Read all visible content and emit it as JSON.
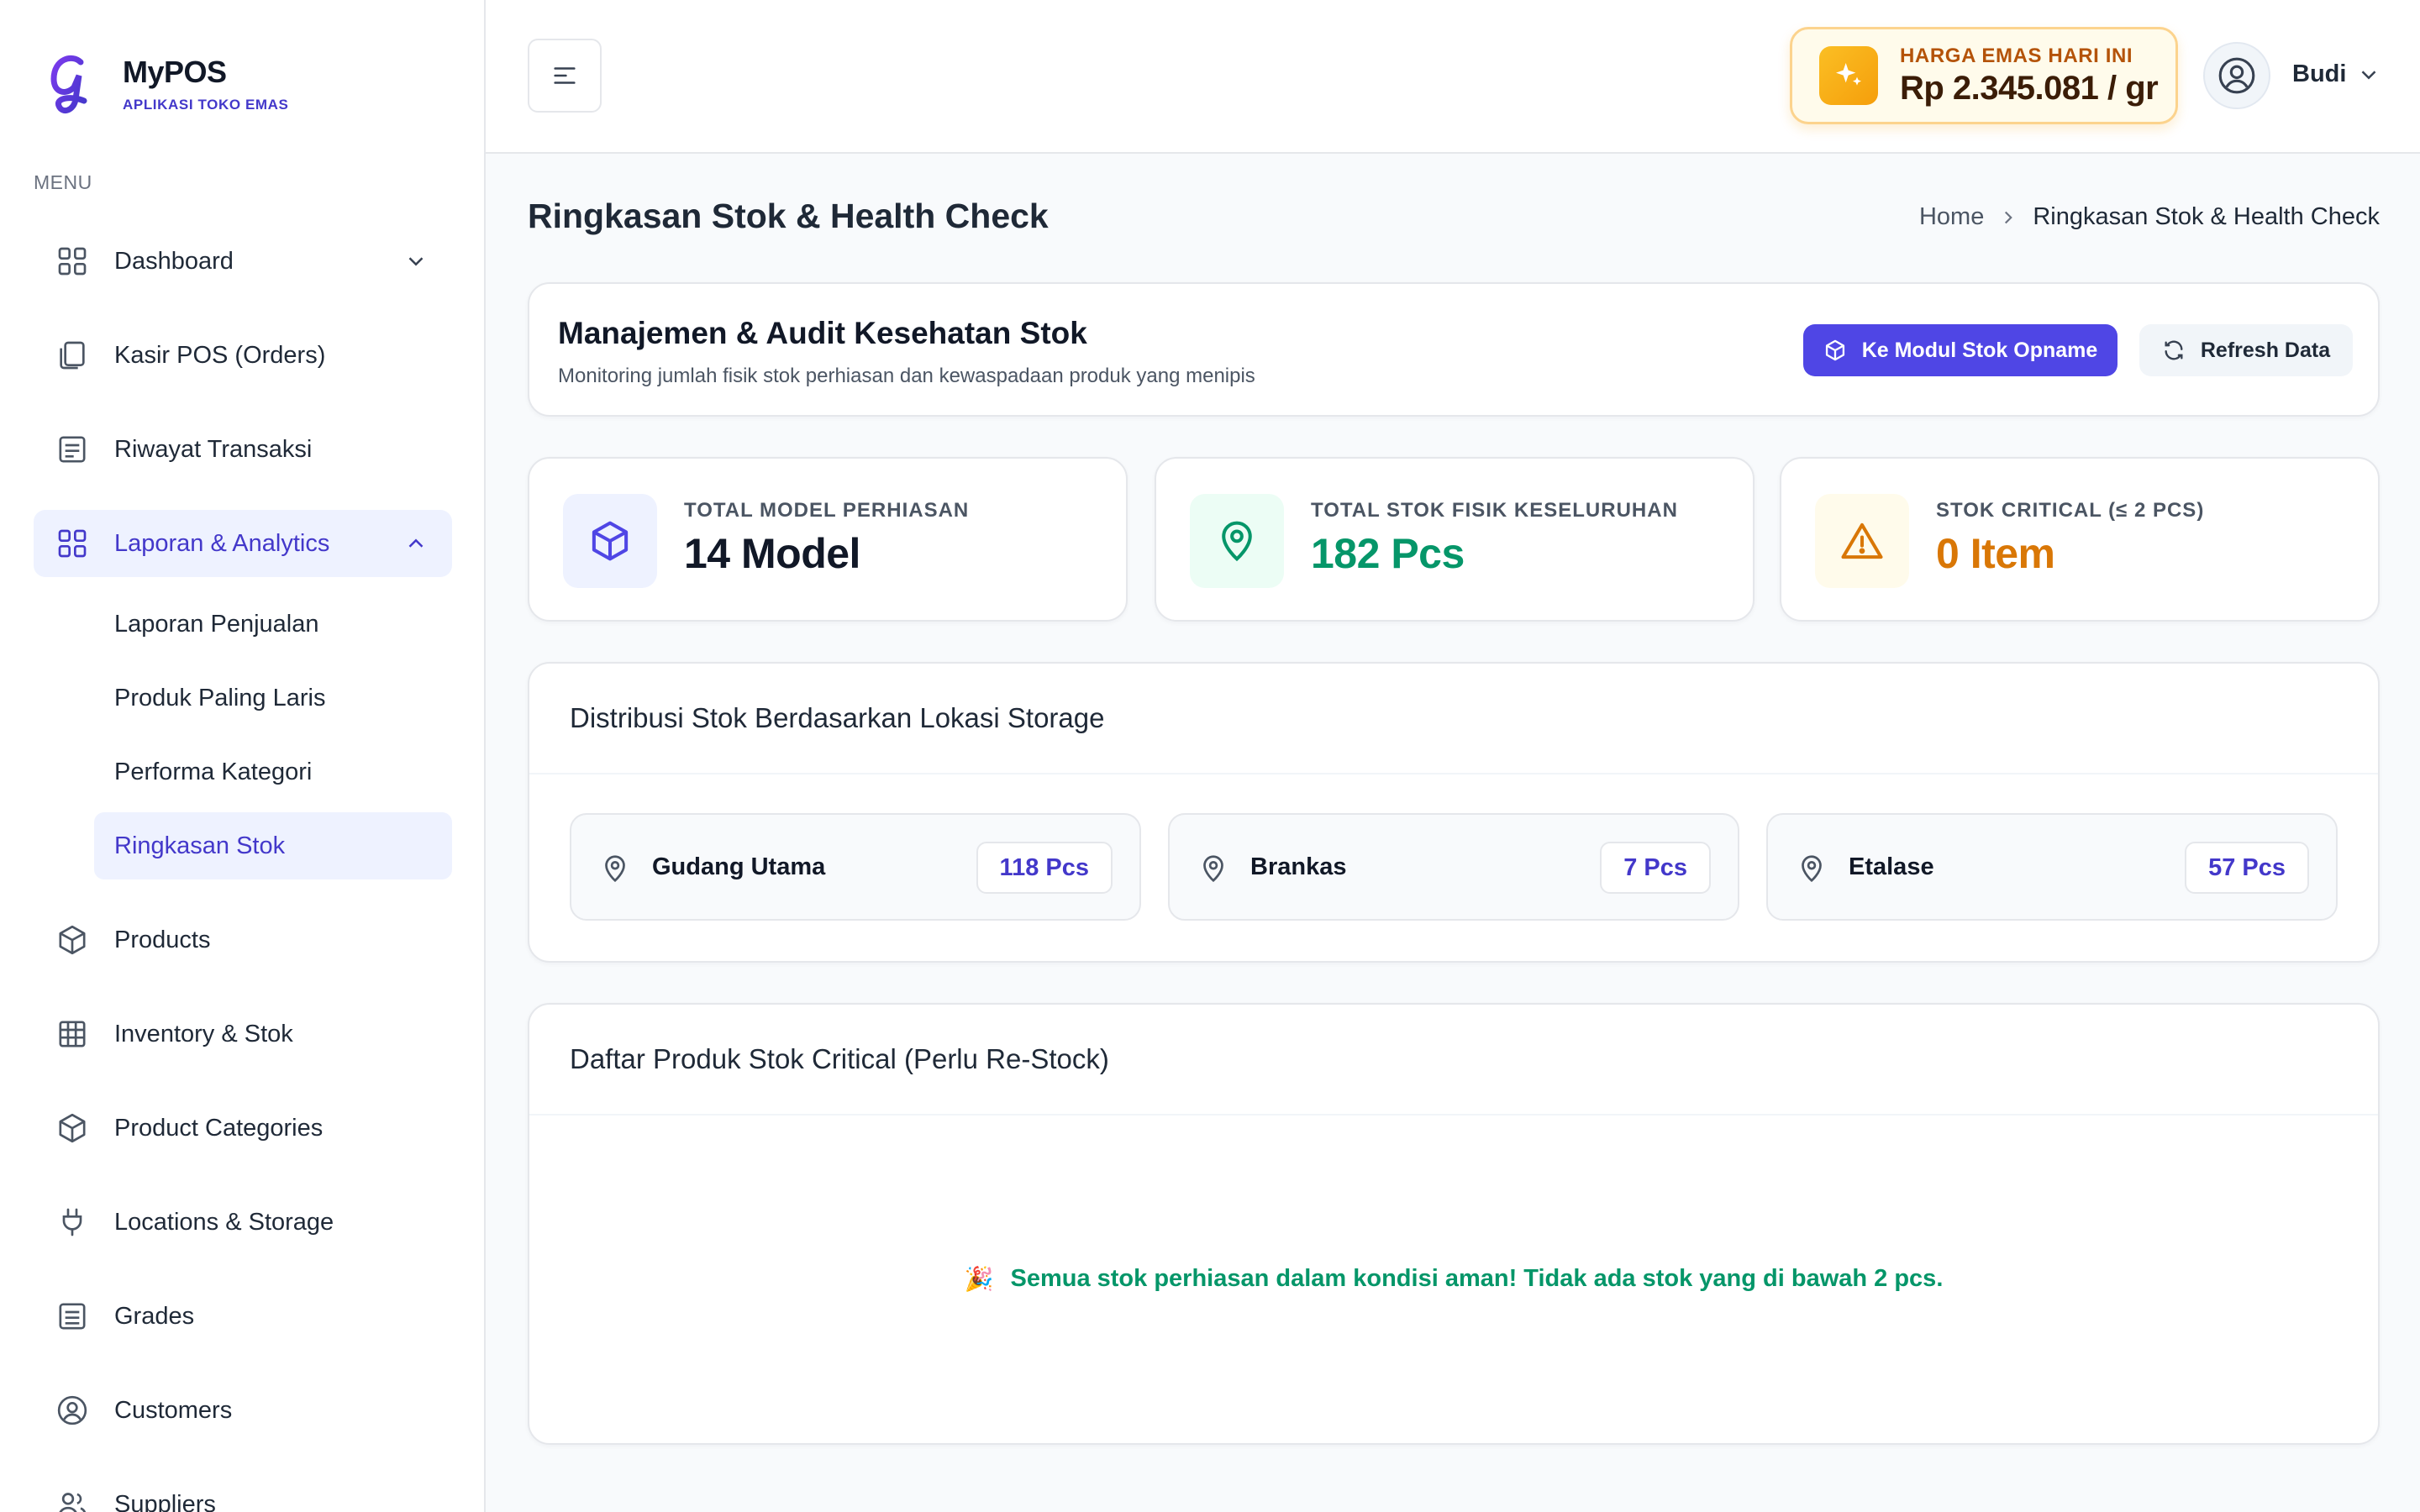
{
  "brand": {
    "title": "MyPOS",
    "subtitle": "APLIKASI TOKO EMAS",
    "logo_icon": "g-script-logo-icon"
  },
  "sidebar": {
    "menu_label": "MENU",
    "items": [
      {
        "label": "Dashboard",
        "icon": "grid-icon",
        "expanded": false
      },
      {
        "label": "Kasir POS (Orders)",
        "icon": "clipboard-icon"
      },
      {
        "label": "Riwayat Transaksi",
        "icon": "receipt-icon"
      },
      {
        "label": "Laporan & Analytics",
        "icon": "grid-icon",
        "expanded": true,
        "active": true
      },
      {
        "label": "Products",
        "icon": "cube-icon"
      },
      {
        "label": "Inventory & Stok",
        "icon": "table-icon"
      },
      {
        "label": "Product Categories",
        "icon": "cube-icon"
      },
      {
        "label": "Locations & Storage",
        "icon": "plug-icon"
      },
      {
        "label": "Grades",
        "icon": "list-icon"
      },
      {
        "label": "Customers",
        "icon": "user-circle-icon"
      },
      {
        "label": "Suppliers",
        "icon": "users-icon"
      }
    ],
    "subitems": [
      {
        "label": "Laporan Penjualan"
      },
      {
        "label": "Produk Paling Laris"
      },
      {
        "label": "Performa Kategori"
      },
      {
        "label": "Ringkasan Stok",
        "active": true
      }
    ]
  },
  "header": {
    "gold_price": {
      "label": "HARGA EMAS HARI INI",
      "value": "Rp 2.345.081 / gr",
      "icon": "sparkles-icon"
    },
    "user": {
      "name": "Budi"
    }
  },
  "page": {
    "title": "Ringkasan Stok & Health Check",
    "breadcrumb": {
      "home": "Home",
      "current": "Ringkasan Stok & Health Check"
    }
  },
  "management": {
    "title": "Manajemen & Audit Kesehatan Stok",
    "subtitle": "Monitoring jumlah fisik stok perhiasan dan kewaspadaan produk yang menipis",
    "primary_button": "Ke Modul Stok Opname",
    "secondary_button": "Refresh Data"
  },
  "stats": [
    {
      "label": "TOTAL MODEL PERHIASAN",
      "value": "14 Model",
      "icon": "cube-icon",
      "color": "#111827",
      "bg": "#eef2ff"
    },
    {
      "label": "TOTAL STOK FISIK KESELURUHAN",
      "value": "182 Pcs",
      "icon": "map-pin-icon",
      "color": "#059669",
      "bg": "#ecfdf5"
    },
    {
      "label": "STOK CRITICAL (≤ 2 PCS)",
      "value": "0 Item",
      "icon": "warning-icon",
      "color": "#d97706",
      "bg": "#fffbeb"
    }
  ],
  "distribution": {
    "title": "Distribusi Stok Berdasarkan Lokasi Storage",
    "locations": [
      {
        "name": "Gudang Utama",
        "count": "118 Pcs"
      },
      {
        "name": "Brankas",
        "count": "7 Pcs"
      },
      {
        "name": "Etalase",
        "count": "57 Pcs"
      }
    ]
  },
  "critical": {
    "title": "Daftar Produk Stok Critical (Perlu Re-Stock)",
    "empty_icon": "🎉",
    "empty_message": "Semua stok perhiasan dalam kondisi aman! Tidak ada stok yang di bawah 2 pcs."
  },
  "colors": {
    "accent": "#4f46e5",
    "accent_text": "#4338ca",
    "success": "#059669",
    "warning": "#d97706",
    "gold_bg": "#fffbeb",
    "gold_border": "#fcd38d"
  }
}
